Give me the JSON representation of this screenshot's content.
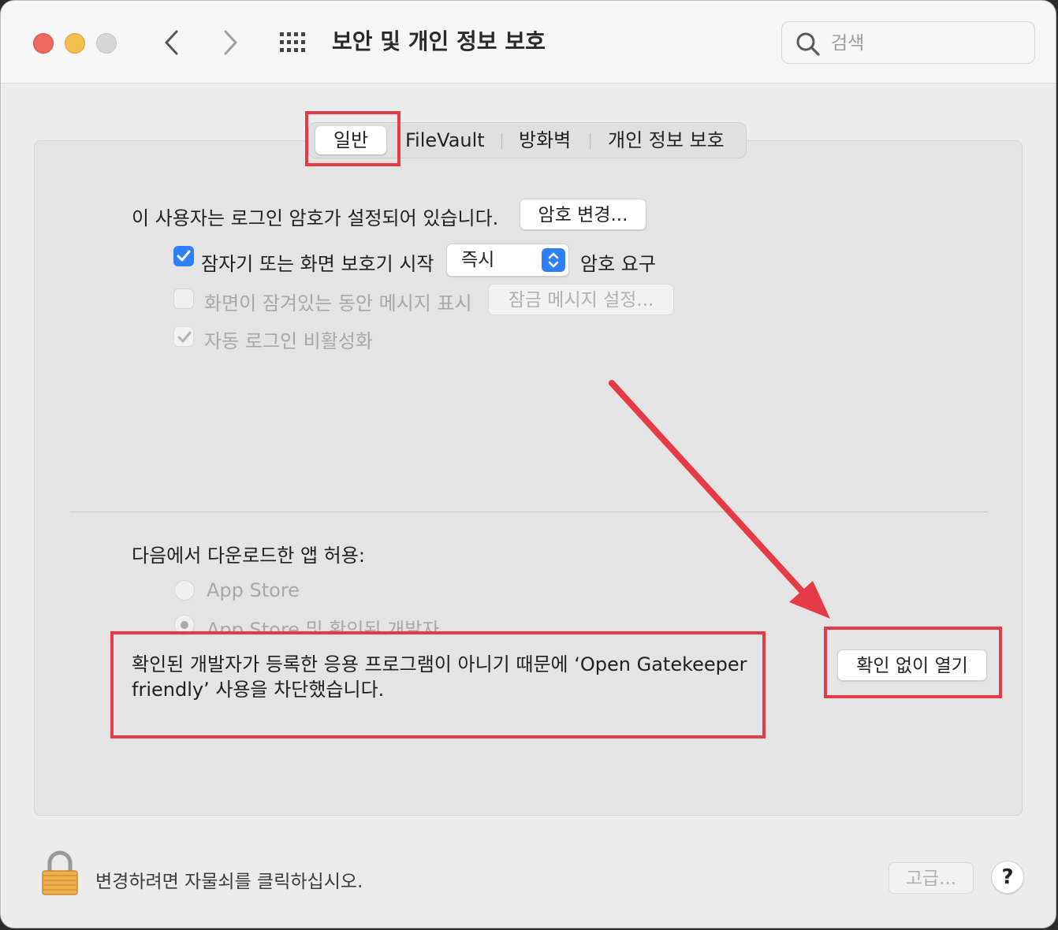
{
  "window": {
    "title": "보안 및 개인 정보 보호",
    "search_placeholder": "검색"
  },
  "tabs": [
    {
      "label": "일반",
      "active": true
    },
    {
      "label": "FileVault",
      "active": false
    },
    {
      "label": "방화벽",
      "active": false
    },
    {
      "label": "개인 정보 보호",
      "active": false
    }
  ],
  "general": {
    "password_text": "이 사용자는 로그인 암호가 설정되어 있습니다.",
    "change_password_button": "암호 변경...",
    "require_password": {
      "checked": true,
      "label": "잠자기 또는 화면 보호기 시작",
      "select_value": "즉시",
      "suffix": "암호 요구"
    },
    "show_message": {
      "checked": false,
      "label": "화면이 잠겨있는 동안 메시지 표시",
      "button": "잠금 메시지 설정..."
    },
    "disable_auto_login": {
      "checked": true,
      "label": "자동 로그인 비활성화"
    }
  },
  "downloads": {
    "heading": "다음에서 다운로드한 앱 허용:",
    "options": [
      {
        "label": "App Store",
        "selected": false
      },
      {
        "label": "App Store 및 확인된 개발자",
        "selected": true
      }
    ],
    "blocked_message": "확인된 개발자가 등록한 응용 프로그램이 아니기 때문에 ‘Open Gatekeeper friendly’ 사용을 차단했습니다.",
    "open_anyway_button": "확인 없이 열기"
  },
  "footer": {
    "lock_text": "변경하려면 자물쇠를 클릭하십시오.",
    "advanced_button": "고급...",
    "help_button": "?"
  },
  "colors": {
    "accent": "#2f7ff6",
    "annotation": "#e53b47"
  }
}
